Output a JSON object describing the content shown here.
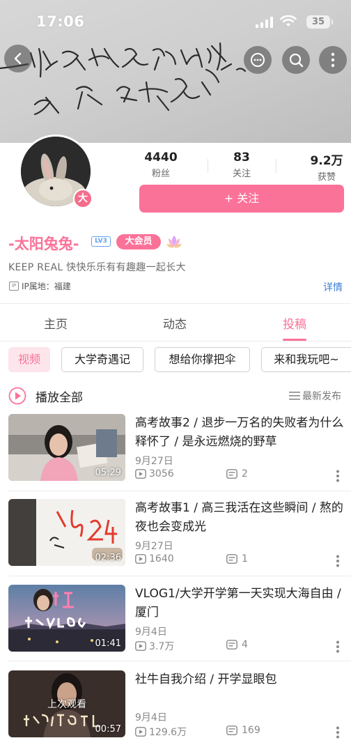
{
  "status_bar": {
    "time": "17:06",
    "battery": "35"
  },
  "profile": {
    "avatar_badge": "大",
    "stats": [
      {
        "value": "4440",
        "label": "粉丝"
      },
      {
        "value": "83",
        "label": "关注"
      },
      {
        "value": "9.2万",
        "label": "获赞"
      }
    ],
    "follow_label": "+ 关注",
    "name": "-太阳兔兔-",
    "level": "LV3",
    "vip_label": "大会员",
    "bio": "KEEP REAL  快快乐乐有有趣趣一起长大",
    "ip_badge": "IP",
    "ip_location": "IP属地：福建",
    "detail_link": "详情"
  },
  "tabs": [
    {
      "label": "主页",
      "active": false
    },
    {
      "label": "动态",
      "active": false
    },
    {
      "label": "投稿",
      "active": true
    }
  ],
  "filters": [
    "视频",
    "大学奇遇记",
    "想给你撑把伞",
    "来和我玩吧~"
  ],
  "list_header": {
    "play_all": "播放全部",
    "sort": "最新发布"
  },
  "videos": [
    {
      "title": "高考故事2 / 退步一万名的失败者为什么释怀了 / 是永远燃烧的野草",
      "date": "9月27日",
      "plays": "3056",
      "comments": "2",
      "duration": "05:29",
      "overlay": ""
    },
    {
      "title": "高考故事1 / 高三我活在这些瞬间 / 熬的夜也会变成光",
      "date": "9月27日",
      "plays": "1640",
      "comments": "1",
      "duration": "02:36",
      "overlay": ""
    },
    {
      "title": "VLOG1/大学开学第一天实现大海自由 / 厦门",
      "date": "9月4日",
      "plays": "3.7万",
      "comments": "4",
      "duration": "01:41",
      "overlay": ""
    },
    {
      "title": "社牛自我介绍 / 开学显眼包",
      "date": "9月4日",
      "plays": "129.6万",
      "comments": "169",
      "duration": "00:57",
      "overlay": "上次观看"
    }
  ],
  "colors": {
    "accent": "#fb7299",
    "link": "#3b7dd8",
    "level": "#60a2f0"
  }
}
